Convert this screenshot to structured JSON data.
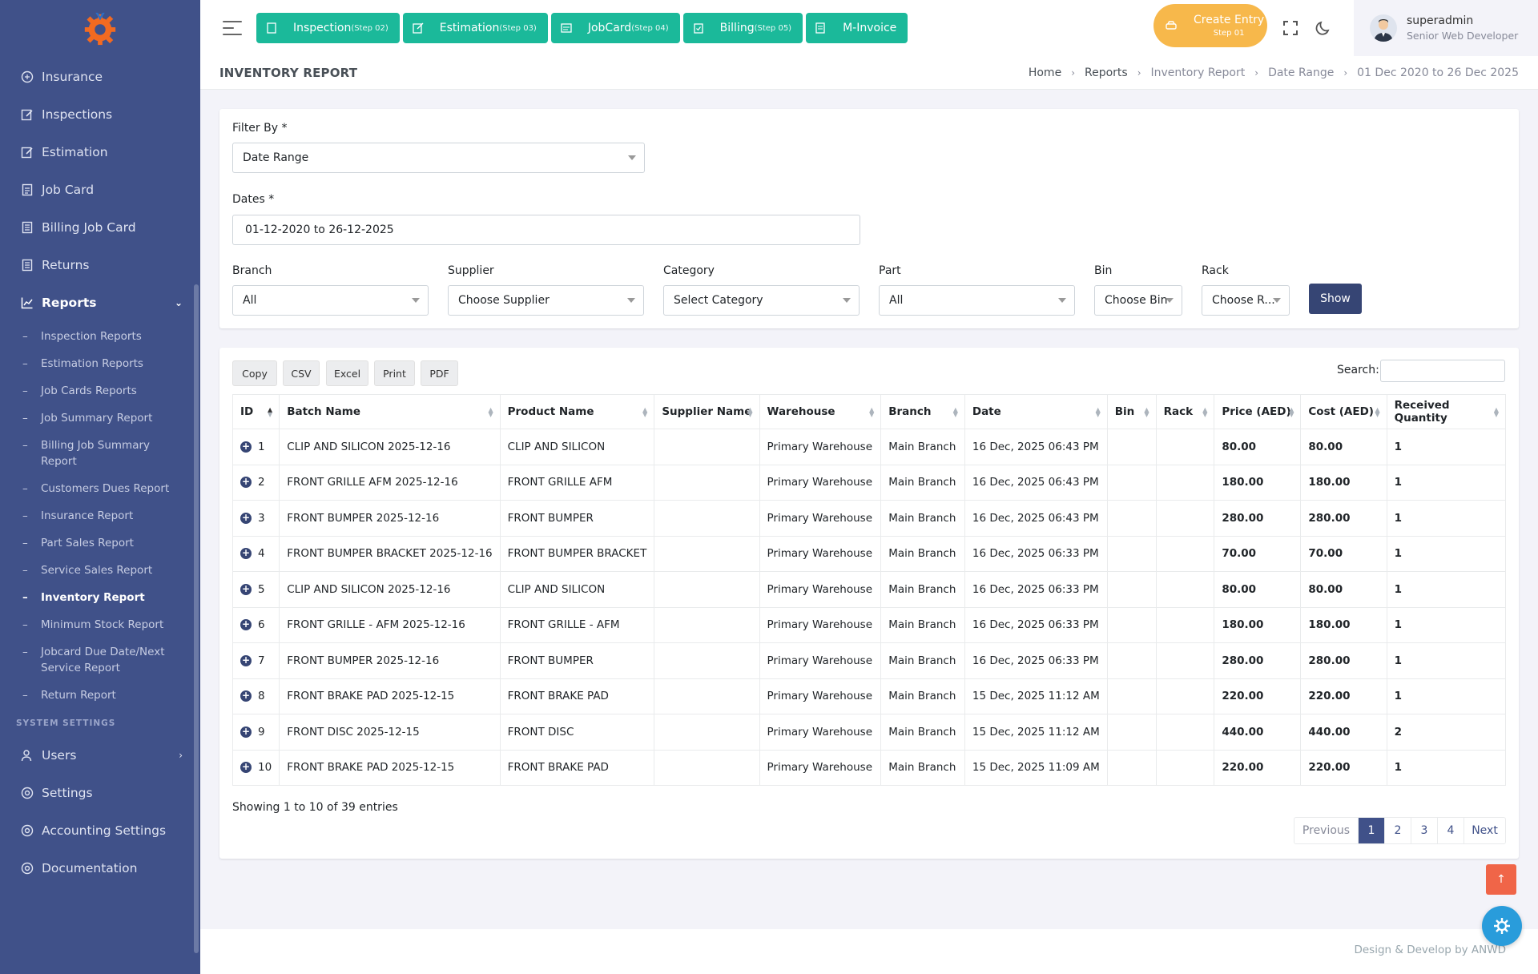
{
  "sidebar": {
    "items": [
      {
        "label": "Insurance",
        "icon": "shield-icon"
      },
      {
        "label": "Inspections",
        "icon": "edit-icon"
      },
      {
        "label": "Estimation",
        "icon": "edit-icon"
      },
      {
        "label": "Job Card",
        "icon": "file-icon"
      },
      {
        "label": "Billing Job Card",
        "icon": "receipt-icon"
      },
      {
        "label": "Returns",
        "icon": "receipt-icon"
      },
      {
        "label": "Reports",
        "icon": "chart-icon"
      }
    ],
    "reports_sub": [
      {
        "label": "Inspection Reports"
      },
      {
        "label": "Estimation Reports"
      },
      {
        "label": "Job Cards Reports"
      },
      {
        "label": "Job Summary Report"
      },
      {
        "label": "Billing Job Summary Report"
      },
      {
        "label": "Customers Dues Report"
      },
      {
        "label": "Insurance Report"
      },
      {
        "label": "Part Sales Report"
      },
      {
        "label": "Service Sales Report"
      },
      {
        "label": "Inventory Report"
      },
      {
        "label": "Minimum Stock Report"
      },
      {
        "label": "Jobcard Due Date/Next Service Report"
      },
      {
        "label": "Return Report"
      }
    ],
    "system_title": "SYSTEM SETTINGS",
    "system_items": [
      {
        "label": "Users"
      },
      {
        "label": "Settings"
      },
      {
        "label": "Accounting Settings"
      },
      {
        "label": "Documentation"
      }
    ]
  },
  "topbar": {
    "steps": [
      {
        "label": "Inspection",
        "step": "(Step 02)"
      },
      {
        "label": "Estimation",
        "step": "(Step 03)"
      },
      {
        "label": "JobCard",
        "step": "(Step 04)"
      },
      {
        "label": "Billing",
        "step": "(Step 05)"
      },
      {
        "label": "M-Invoice",
        "step": ""
      }
    ],
    "create_entry": "Create Entry",
    "create_step": "Step 01",
    "user_name": "superadmin",
    "user_role": "Senior Web Developer"
  },
  "page": {
    "title": "INVENTORY REPORT",
    "breadcrumb": [
      "Home",
      "Reports",
      "Inventory Report",
      "Date Range",
      "01 Dec 2020 to 26 Dec 2025"
    ]
  },
  "filters": {
    "filter_by_label": "Filter By *",
    "filter_by_value": "Date Range",
    "dates_label": "Dates *",
    "dates_value": "01-12-2020 to 26-12-2025",
    "branch_label": "Branch",
    "branch_value": "All",
    "supplier_label": "Supplier",
    "supplier_value": "Choose Supplier",
    "category_label": "Category",
    "category_value": "Select Category",
    "part_label": "Part",
    "part_value": "All",
    "bin_label": "Bin",
    "bin_value": "Choose Bin",
    "rack_label": "Rack",
    "rack_value": "Choose R...",
    "show_label": "Show"
  },
  "table": {
    "buttons": [
      "Copy",
      "CSV",
      "Excel",
      "Print",
      "PDF"
    ],
    "search_label": "Search:",
    "columns": [
      "ID",
      "Batch Name",
      "Product Name",
      "Supplier Name",
      "Warehouse",
      "Branch",
      "Date",
      "Bin",
      "Rack",
      "Price (AED)",
      "Cost (AED)",
      "Received Quantity"
    ],
    "rows": [
      [
        "1",
        "CLIP AND SILICON 2025-12-16",
        "CLIP AND SILICON",
        "",
        "Primary Warehouse",
        "Main Branch",
        "16 Dec, 2025 06:43 PM",
        "",
        "",
        "80.00",
        "80.00",
        "1"
      ],
      [
        "2",
        "FRONT GRILLE AFM 2025-12-16",
        "FRONT GRILLE AFM",
        "",
        "Primary Warehouse",
        "Main Branch",
        "16 Dec, 2025 06:43 PM",
        "",
        "",
        "180.00",
        "180.00",
        "1"
      ],
      [
        "3",
        "FRONT BUMPER 2025-12-16",
        "FRONT BUMPER",
        "",
        "Primary Warehouse",
        "Main Branch",
        "16 Dec, 2025 06:43 PM",
        "",
        "",
        "280.00",
        "280.00",
        "1"
      ],
      [
        "4",
        "FRONT BUMPER BRACKET 2025-12-16",
        "FRONT BUMPER BRACKET",
        "",
        "Primary Warehouse",
        "Main Branch",
        "16 Dec, 2025 06:33 PM",
        "",
        "",
        "70.00",
        "70.00",
        "1"
      ],
      [
        "5",
        "CLIP AND SILICON 2025-12-16",
        "CLIP AND SILICON",
        "",
        "Primary Warehouse",
        "Main Branch",
        "16 Dec, 2025 06:33 PM",
        "",
        "",
        "80.00",
        "80.00",
        "1"
      ],
      [
        "6",
        "FRONT GRILLE - AFM 2025-12-16",
        "FRONT GRILLE - AFM",
        "",
        "Primary Warehouse",
        "Main Branch",
        "16 Dec, 2025 06:33 PM",
        "",
        "",
        "180.00",
        "180.00",
        "1"
      ],
      [
        "7",
        "FRONT BUMPER 2025-12-16",
        "FRONT BUMPER",
        "",
        "Primary Warehouse",
        "Main Branch",
        "16 Dec, 2025 06:33 PM",
        "",
        "",
        "280.00",
        "280.00",
        "1"
      ],
      [
        "8",
        "FRONT BRAKE PAD 2025-12-15",
        "FRONT BRAKE PAD",
        "",
        "Primary Warehouse",
        "Main Branch",
        "15 Dec, 2025 11:12 AM",
        "",
        "",
        "220.00",
        "220.00",
        "1"
      ],
      [
        "9",
        "FRONT DISC 2025-12-15",
        "FRONT DISC",
        "",
        "Primary Warehouse",
        "Main Branch",
        "15 Dec, 2025 11:12 AM",
        "",
        "",
        "440.00",
        "440.00",
        "2"
      ],
      [
        "10",
        "FRONT BRAKE PAD 2025-12-15",
        "FRONT BRAKE PAD",
        "",
        "Primary Warehouse",
        "Main Branch",
        "15 Dec, 2025 11:09 AM",
        "",
        "",
        "220.00",
        "220.00",
        "1"
      ]
    ],
    "info": "Showing 1 to 10 of 39 entries",
    "pager": [
      "Previous",
      "1",
      "2",
      "3",
      "4",
      "Next"
    ]
  },
  "footer": "Design & Develop by ANWD",
  "colors": {
    "sidebar": "#405189",
    "accent": "#1bb99a",
    "warning": "#f7b84b",
    "danger": "#f06548",
    "info": "#299cdb"
  }
}
